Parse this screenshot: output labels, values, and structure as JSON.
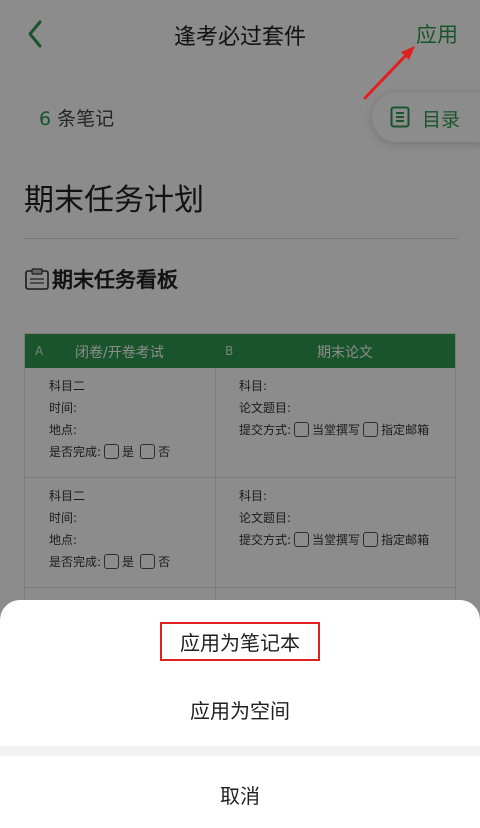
{
  "topbar": {
    "title": "逢考必过套件",
    "apply_label": "应用"
  },
  "notes": {
    "count": "6",
    "count_suffix": " 条笔记",
    "toc_label": "目录"
  },
  "document": {
    "title": "期末任务计划",
    "board_title": "期末任务看板"
  },
  "table": {
    "columns": [
      {
        "letter": "A",
        "name": "闭卷/开卷考试"
      },
      {
        "letter": "B",
        "name": "期末论文"
      }
    ],
    "rows": [
      {
        "left": {
          "subject": "科目二",
          "time": "时间:",
          "place": "地点:",
          "done": "是否完成:",
          "yes": "是",
          "no": "否"
        },
        "right": {
          "subject": "科目:",
          "topic": "论文题目:",
          "submit": "提交方式:",
          "opt1": "当堂撰写",
          "opt2": "指定邮箱"
        }
      },
      {
        "left": {
          "subject": "科目二",
          "time": "时间:",
          "place": "地点:",
          "done": "是否完成:",
          "yes": "是",
          "no": "否"
        },
        "right": {
          "subject": "科目:",
          "topic": "论文题目:",
          "submit": "提交方式:",
          "opt1": "当堂撰写",
          "opt2": "指定邮箱"
        }
      }
    ]
  },
  "sheet": {
    "apply_notebook": "应用为笔记本",
    "apply_space": "应用为空间",
    "cancel": "取消"
  },
  "colors": {
    "accent": "#2e9a4f",
    "highlight": "#e02020"
  }
}
